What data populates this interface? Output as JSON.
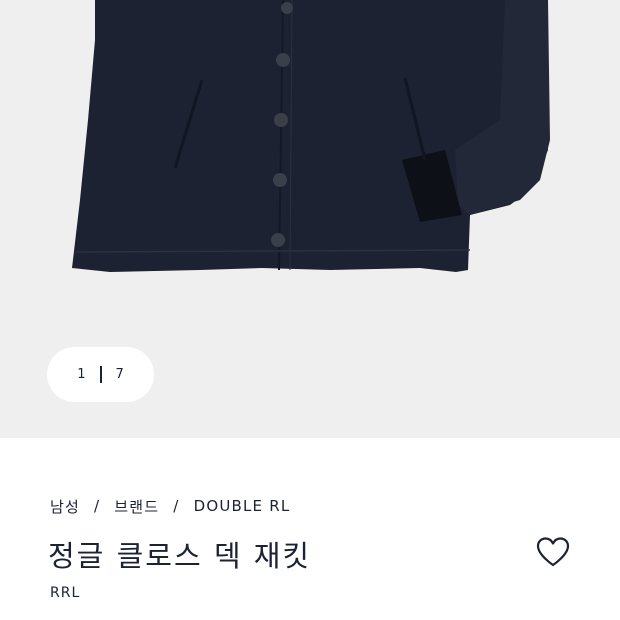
{
  "gallery": {
    "pager": {
      "current": "1",
      "total": "7"
    }
  },
  "breadcrumb": [
    "남성",
    "브랜드",
    "DOUBLE RL"
  ],
  "product": {
    "title": "정글 클로스 덱 재킷",
    "brand": "RRL"
  },
  "colors": {
    "text": "#1b2236",
    "gallery_bg": "#f0efef",
    "jacket": "#1d2232"
  },
  "icons": {
    "wishlist": "heart-outline-icon"
  }
}
